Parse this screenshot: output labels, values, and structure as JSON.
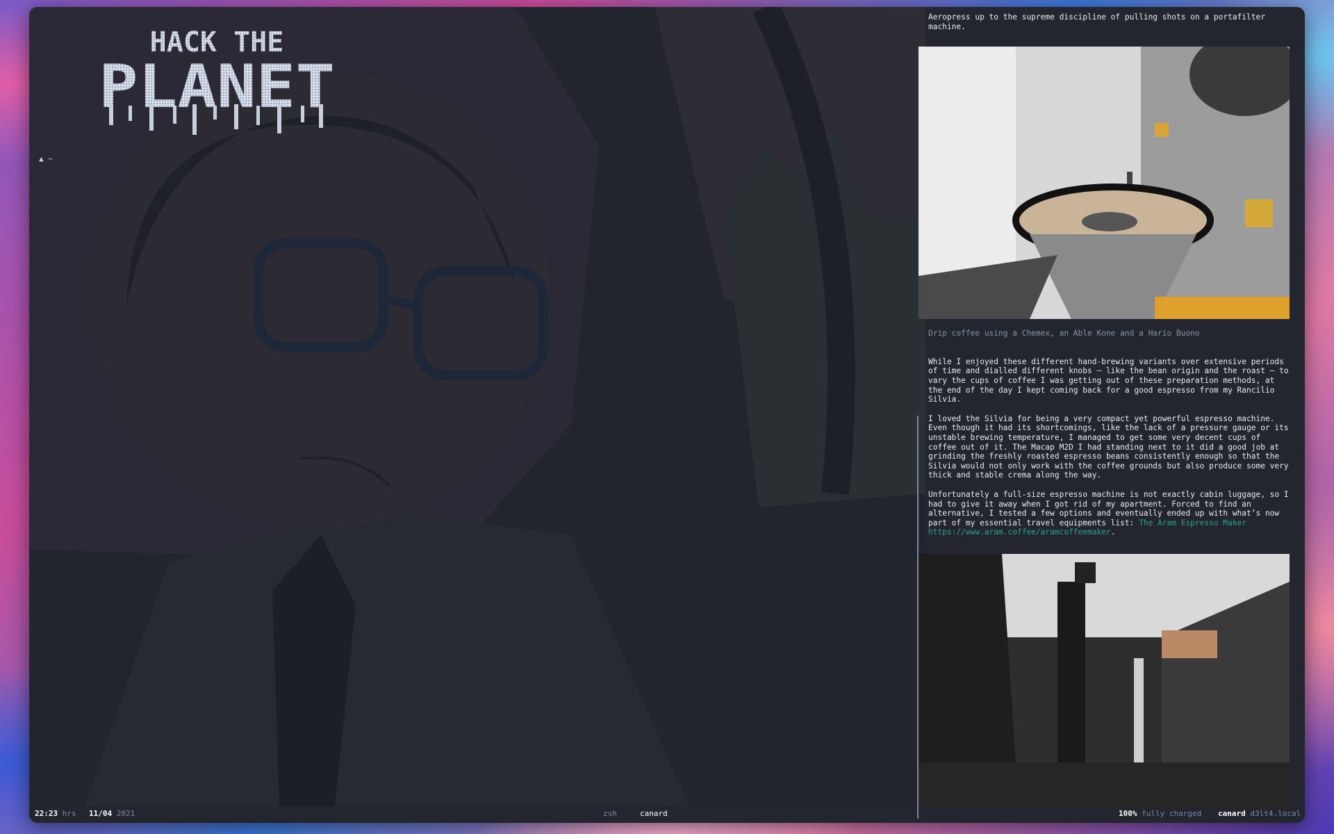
{
  "prompt": {
    "glyph": "▲",
    "path": "~"
  },
  "logo": {
    "line1": "HACK THE",
    "line2": "PLANET"
  },
  "article": {
    "lead": "Aeropress up to the supreme discipline of pulling shots on a portafilter machine.",
    "caption": "Drip coffee using a Chemex, an Able Kone and a Hario Buono",
    "para1": "While I enjoyed these different hand-brewing variants over extensive periods of time and dialled different knobs — like the bean origin and the roast — to vary the cups of coffee I was getting out of these preparation methods, at the end of the day I kept coming back for a good espresso from my Rancilio Silvia.",
    "para2": "I loved the Silvia for being a very compact yet powerful espresso machine. Even though it had its shortcomings, like the lack of a pressure gauge or its unstable brewing temperature, I managed to get some very decent cups of coffee out of it. The Macap M2D I had standing next to it did a good job at grinding the freshly roasted espresso beans consistently enough so that the Silvia would not only work with the coffee grounds but also produce some very thick and stable crema along the way.",
    "para3_text": "Unfortunately a full-size espresso machine is not exactly cabin luggage, so I had to give it away when I got rid of my apartment. Forced to find an alternative, I tested a few options and eventually ended up with what’s now part of my essential travel equipments list: ",
    "para3_link_title": "The Aram Espresso Maker",
    "para3_link_url": "https://www.aram.coffee/aramcoffeemaker",
    "para3_tail": "."
  },
  "statusbar": {
    "time": "22:23",
    "time_unit": "hrs",
    "date": "11/04",
    "year": "2021",
    "shell": "zsh",
    "session": "canard",
    "battery": "100%",
    "battery_state": "fully charged",
    "user": "canard",
    "host": "d3lt4.local"
  }
}
